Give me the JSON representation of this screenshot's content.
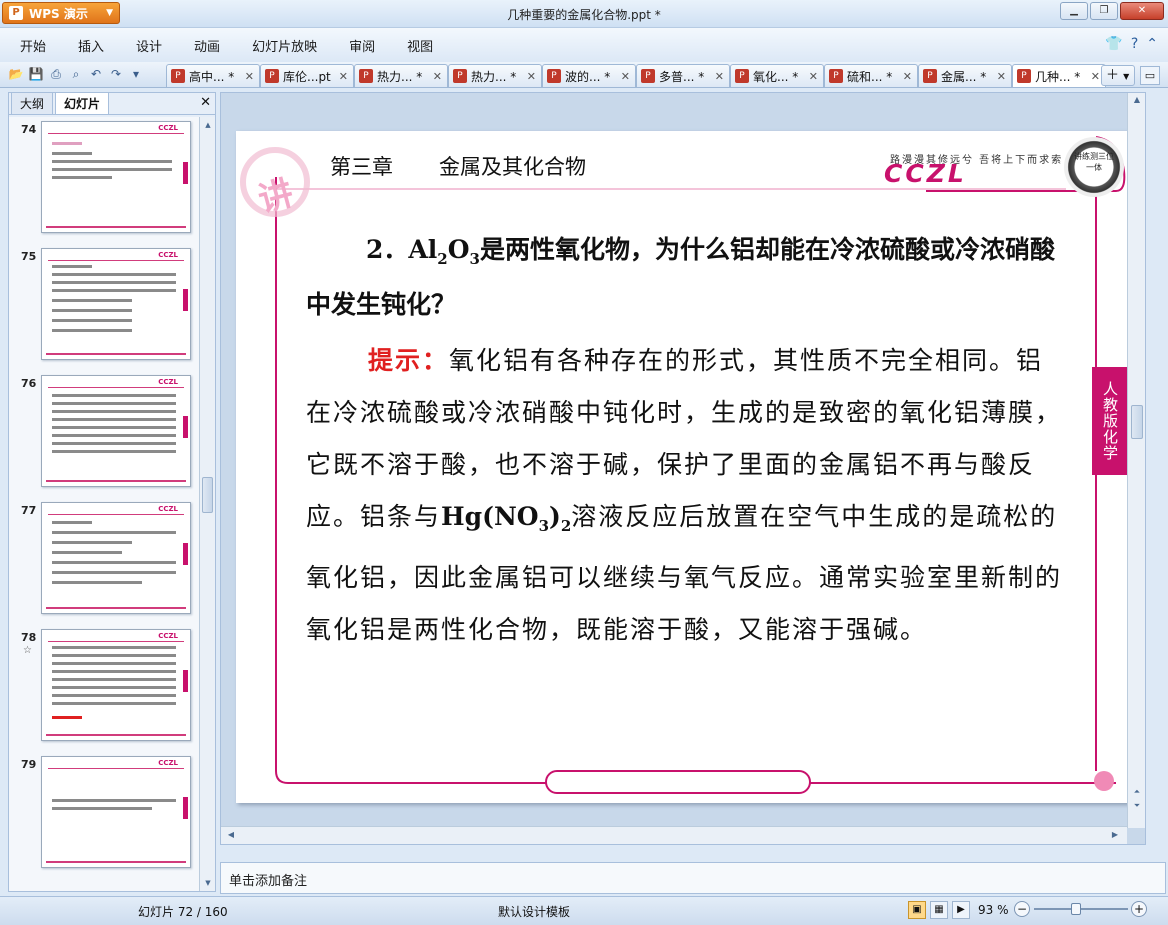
{
  "app": {
    "button_label": "WPS 演示",
    "logo_glyph": "P",
    "window_title": "几种重要的金属化合物.ppt *"
  },
  "menu": {
    "items": [
      "开始",
      "插入",
      "设计",
      "动画",
      "幻灯片放映",
      "审阅",
      "视图"
    ]
  },
  "tabs": [
    {
      "label": "高中... *"
    },
    {
      "label": "库伦...pt"
    },
    {
      "label": "热力... *"
    },
    {
      "label": "热力... *"
    },
    {
      "label": "波的... *"
    },
    {
      "label": "多普... *"
    },
    {
      "label": "氧化... *"
    },
    {
      "label": "硫和... *"
    },
    {
      "label": "金属... *"
    },
    {
      "label": "几种... *"
    }
  ],
  "left_panel": {
    "tab_outline": "大纲",
    "tab_slides": "幻灯片",
    "thumbnails": [
      {
        "num": "74",
        "star": ""
      },
      {
        "num": "75",
        "star": ""
      },
      {
        "num": "76",
        "star": ""
      },
      {
        "num": "77",
        "star": ""
      },
      {
        "num": "78",
        "star": "☆"
      },
      {
        "num": "79",
        "star": ""
      }
    ],
    "thumb_brand": "CCZL"
  },
  "slide": {
    "chapter_num": "第三章",
    "chapter_title": "金属及其化合物",
    "motto": "路漫漫其修远兮  吾将上下而求索",
    "brand": "CCZL",
    "badge": "讲练测三位一体",
    "swirl_char": "讲",
    "side_tab": "人教版化学",
    "question": {
      "prefix": "2．Al",
      "sub1": "2",
      "mid": "O",
      "sub2": "3",
      "rest": "是两性氧化物，为什么铝却能在冷浓硫酸或冷浓硝酸中发生钝化？"
    },
    "answer": {
      "hint_label": "提示：",
      "part1": "氧化铝有各种存在的形式，其性质不完全相同。铝在冷浓硫酸或冷浓硝酸中钝化时，生成的是致密的氧化铝薄膜，它既不溶于酸，也不溶于碱，保护了里面的金属铝不再与酸反应。铝条与",
      "chem_a": "Hg(NO",
      "chem_sub1": "3",
      "chem_b": ")",
      "chem_sub2": "2",
      "part2": "溶液反应后放置在空气中生成的是疏松的氧化铝，因此金属铝可以继续与氧气反应。通常实验室里新制的氧化铝是两性化合物，既能溶于酸，又能溶于强碱。"
    }
  },
  "notes": {
    "placeholder": "单击添加备注"
  },
  "status": {
    "slide_counter": "幻灯片 72 / 160",
    "template": "默认设计模板",
    "zoom": "93 %",
    "zoom_level": 0.45
  },
  "colors": {
    "accent": "#c8116c",
    "hint": "#e02020"
  }
}
